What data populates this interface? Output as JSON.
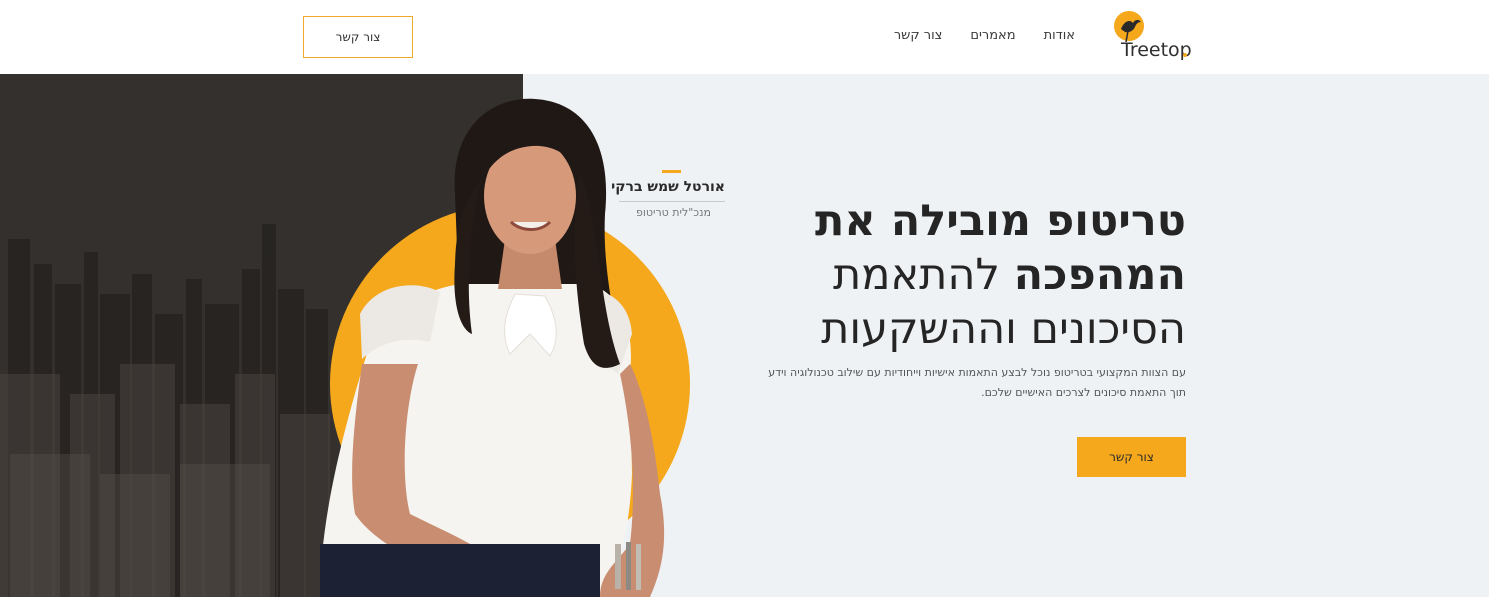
{
  "brand": {
    "logo_text": "Treetop",
    "accent_color": "#f5a81c",
    "logo_icon": "bird-icon"
  },
  "nav": {
    "items": [
      "אודות",
      "מאמרים",
      "צור קשר"
    ]
  },
  "header": {
    "contact_button": "צור קשר"
  },
  "hero": {
    "person_name": "אורטל שמש ברקי",
    "person_role": "מנכ\"לית טריטופ",
    "headline_line1": "טריטופ מובילה את",
    "headline_line2_bold": "המהפכה",
    "headline_line2_light": " להתאמת",
    "headline_line3": "הסיכונים וההשקעות",
    "subtext": "עם הצוות המקצועי בטריטופ נוכל לבצע התאמות אישיות וייחודיות עם שילוב טכנולוגיה וידע תוך התאמת סיכונים לצרכים האישיים שלכם.",
    "cta_button": "צור קשר",
    "background_color": "#eff2f5",
    "city_overlay_color": "#332f2d"
  }
}
